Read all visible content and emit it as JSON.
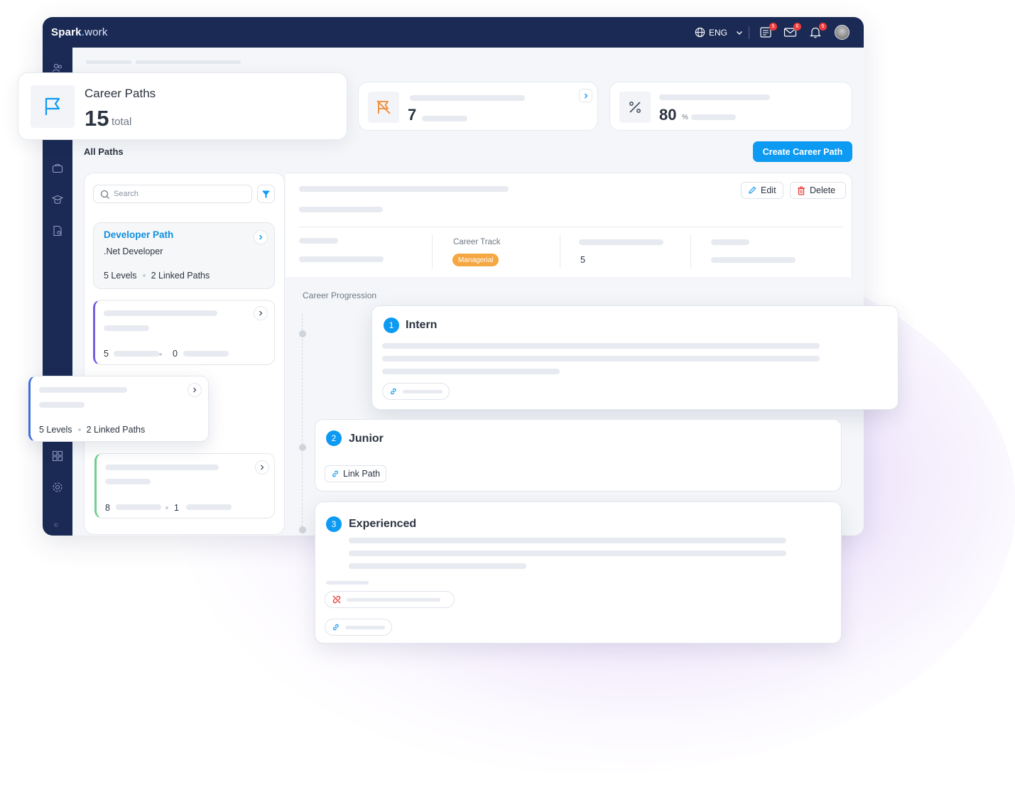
{
  "app": {
    "brand": "Spark",
    "brand_suffix": "work",
    "copyright": "©"
  },
  "topbar": {
    "language": "ENG",
    "tasks_badge": "5",
    "mail_badge": "6",
    "notifications_badge": "5"
  },
  "stats": {
    "career_paths_title": "Career Paths",
    "career_paths_count": "15",
    "career_paths_unit": "total",
    "second_value": "7",
    "third_value": "80",
    "third_unit": "%"
  },
  "section": {
    "title": "All Paths",
    "create_button": "Create Career Path"
  },
  "list": {
    "search_placeholder": "Search",
    "items": [
      {
        "title": "Developer Path",
        "subtitle": ".Net Developer",
        "levels": "5 Levels",
        "linked": "2 Linked Paths"
      },
      {
        "levels": "5",
        "linked": "0"
      },
      {
        "levels": "5 Levels",
        "linked": "2 Linked Paths"
      },
      {
        "levels": "8",
        "linked": "1"
      }
    ]
  },
  "detail": {
    "edit_label": "Edit",
    "delete_label": "Delete",
    "career_track_label": "Career Track",
    "career_track_value": "Managerial",
    "levels_value": "5",
    "progression_title": "Career Progression",
    "stages": [
      {
        "number": "1",
        "title": "Intern"
      },
      {
        "number": "2",
        "title": "Junior",
        "link_label": "Link Path"
      },
      {
        "number": "3",
        "title": "Experienced"
      }
    ]
  },
  "colors": {
    "navy": "#1b2a54",
    "accent": "#0d9af2",
    "tag": "#f5a742",
    "danger": "#e53935"
  }
}
